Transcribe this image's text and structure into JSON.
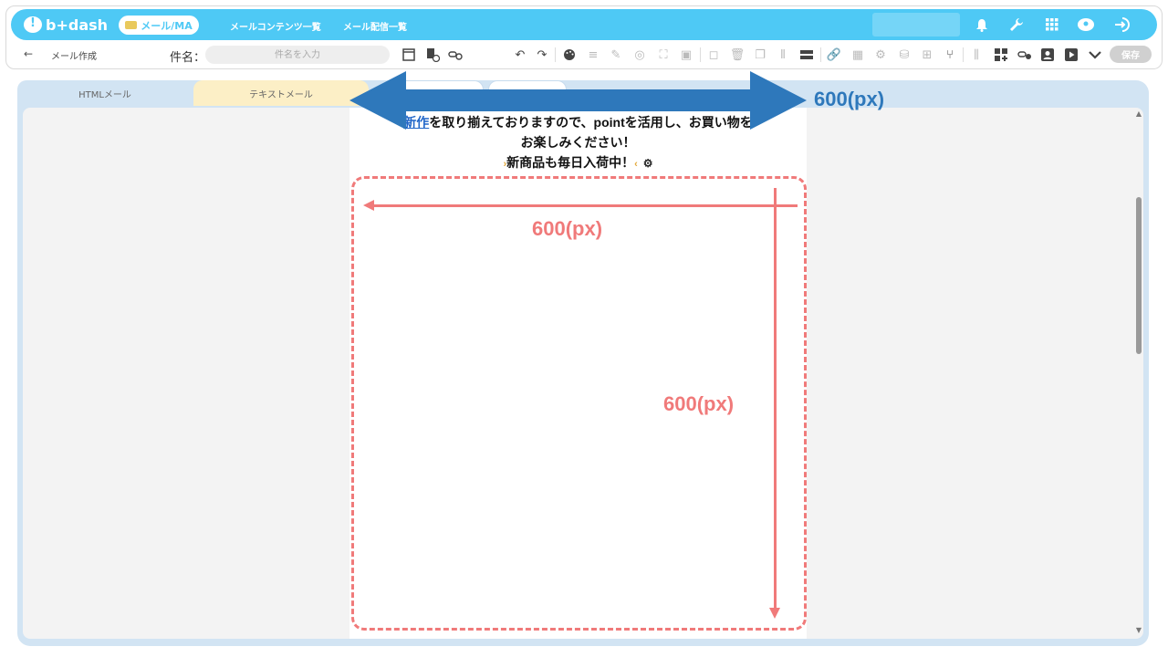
{
  "header": {
    "logo_text": "b+dash",
    "mode_label": "メール/MA",
    "nav": [
      "メールコンテンツ一覧",
      "メール配信一覧"
    ],
    "icons": [
      "bell-icon",
      "wrench-icon",
      "grid-icon",
      "user-switch-icon",
      "logout-icon"
    ]
  },
  "toolbar": {
    "back_glyph": "←",
    "page_title": "メール作成",
    "subject_label": "件名：",
    "subject_placeholder": "件名を入力",
    "save_label": "保存"
  },
  "tabs": [
    {
      "label": "HTMLメール"
    },
    {
      "label": "テキストメール"
    }
  ],
  "email_preview": {
    "line1_link": "新作",
    "line1_rest": "を取り揃えておりますので、pointを活用し、お買い物を",
    "line2": "お楽しみください！",
    "line3": "新商品も毎日入荷中！"
  },
  "annotations": {
    "blue_width_label": "600(px)",
    "red_width_label": "600(px)",
    "red_height_label": "600(px)",
    "blue_color": "#2e78bb",
    "red_color": "#f07a7a"
  },
  "colors": {
    "brand": "#4ec9f5",
    "html_tab": "#d2e4f3",
    "text_tab": "#fcefc6"
  }
}
